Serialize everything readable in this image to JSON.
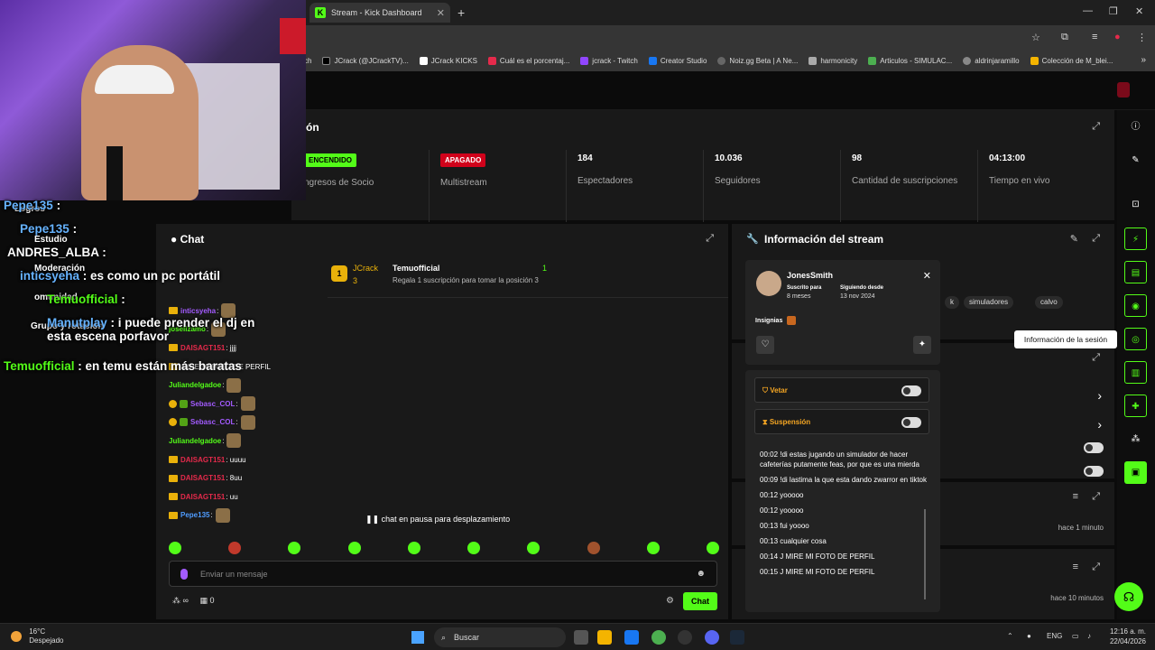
{
  "browser": {
    "tab_title": "Stream - Kick Dashboard",
    "bookmarks": [
      "ch",
      "JCrack (@JCrackTV)...",
      "JCrack KICKS",
      "Cuál es el porcentaj...",
      "jcrack - Twitch",
      "Creator Studio",
      "Noiz.gg Beta | A Ne...",
      "harmonicity",
      "Articulos - SIMULAC...",
      "aldrinjaramillo",
      "Colección de M_blei..."
    ]
  },
  "stats": {
    "title_fragment": "ón",
    "items": [
      {
        "value": "ENCENDIDO",
        "label": "ngresos de Socio",
        "badge": "green"
      },
      {
        "value": "APAGADO",
        "label": "Multistream",
        "badge": "red"
      },
      {
        "value": "184",
        "label": "Espectadores"
      },
      {
        "value": "10.036",
        "label": "Seguidores"
      },
      {
        "value": "98",
        "label": "Cantidad de suscripciones"
      },
      {
        "value": "04:13:00",
        "label": "Tiempo en vivo"
      }
    ]
  },
  "chat": {
    "title": "Chat",
    "pinned": {
      "rank": "1",
      "name": "JCrack",
      "count": "3",
      "user": "Temuofficial",
      "desc": "Regala 1 suscripción para tomar la posición 3",
      "right_count": "1"
    },
    "messages": [
      {
        "user": "inticsyeha",
        "color": "#a35bff",
        "text": ":",
        "badges": [
          "crown"
        ]
      },
      {
        "user": "joselizamo",
        "color": "#53fc18",
        "text": ":",
        "badges": []
      },
      {
        "user": "DAISAGT151",
        "color": "#e52a4b",
        "text": ": jjjj",
        "badges": [
          "crown"
        ]
      },
      {
        "user": "",
        "color": "#ffffff",
        "text": "MIRE MI FOTO DE PERFIL",
        "badges": [
          "crown"
        ]
      },
      {
        "user": "Juliandelgadoe",
        "color": "#53fc18",
        "text": ":",
        "badges": []
      },
      {
        "user": "Sebasc_COL",
        "color": "#a35bff",
        "text": ":",
        "badges": [
          "coin",
          "sub"
        ]
      },
      {
        "user": "Sebasc_COL",
        "color": "#a35bff",
        "text": ":",
        "badges": [
          "coin",
          "sub"
        ]
      },
      {
        "user": "Juliandelgadoe",
        "color": "#53fc18",
        "text": ":",
        "badges": []
      },
      {
        "user": "DAISAGT151",
        "color": "#e52a4b",
        "text": ": uuuu",
        "badges": [
          "crown"
        ]
      },
      {
        "user": "DAISAGT151",
        "color": "#e52a4b",
        "text": ": 8uu",
        "badges": [
          "crown"
        ]
      },
      {
        "user": "DAISAGT151",
        "color": "#e52a4b",
        "text": ": uu",
        "badges": [
          "crown"
        ]
      },
      {
        "user": "Pepe135",
        "color": "#4f9cff",
        "text": ":",
        "badges": [
          "crown"
        ]
      }
    ],
    "paused_text": "chat en pausa para desplazamiento",
    "input_placeholder": "Enviar un mensaje",
    "footer_count": "0",
    "footer_infinity": "∞",
    "send_label": "Chat"
  },
  "stream_info": {
    "title": "Información del stream",
    "tags": [
      "k",
      "simuladores",
      "calvo"
    ]
  },
  "user_card": {
    "name": "JonesSmith",
    "sub_label": "Suscrito para",
    "sub_value": "8 meses",
    "follow_label": "Siguiendo desde",
    "follow_value": "13 nov 2024",
    "insignias": "Insignias"
  },
  "moderation": {
    "vetar": "Vetar",
    "suspension": "Suspensión",
    "logs": [
      "00:02 !di estas jugando un simulador de hacer cafeterías putamente feas, por que es una mierda",
      "00:09 !di lastima la que esta dando zwarror en tiktok",
      "00:12 yooooo",
      "00:12 yooooo",
      "00:13 fui yoooo",
      "00:13 cualquier cosa",
      "00:14 J MIRE MI FOTO DE PERFIL",
      "00:15 J MIRE MI FOTO DE PERFIL"
    ]
  },
  "activity": {
    "time1": "hace 1 minuto",
    "time2": "hace 10 minutos"
  },
  "tooltip": "Información de la sesión",
  "overlay": {
    "lines": [
      {
        "user": "Pepe135",
        "text": ":"
      },
      {
        "user": "Pepe135",
        "text": ":"
      },
      {
        "user": "ANDRES_ALBA",
        "text": ":"
      },
      {
        "user": "inticsyeha",
        "text": ": es como un pc portátil"
      },
      {
        "user": "Temuofficial",
        "text": ":"
      },
      {
        "user": "Manutplay",
        "text": ": i puede prender el dj en esta escena porfavor"
      },
      {
        "user": "Temuofficial",
        "text": ": en temu están más baratas"
      }
    ],
    "menu": [
      "Logros",
      "Estudio",
      "Moderación",
      "omunidad",
      "Grupo y rotación",
      "n ha"
    ]
  },
  "taskbar": {
    "temp": "16°C",
    "weather": "Despejado",
    "search": "Buscar",
    "lang": "ENG",
    "time": "12:16 a. m.",
    "date": "22/04/2026"
  }
}
